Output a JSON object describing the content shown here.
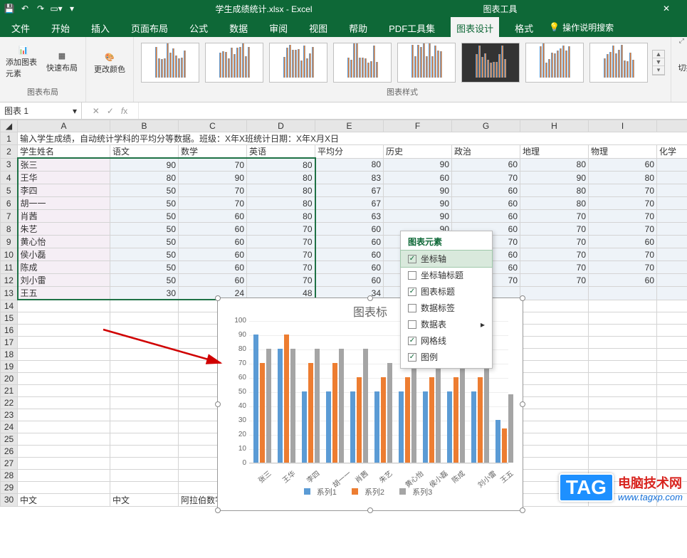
{
  "titlebar": {
    "filename": "学生成绩统计.xlsx - Excel",
    "chart_tools": "图表工具",
    "close": "✕"
  },
  "tabs": {
    "file": "文件",
    "home": "开始",
    "insert": "插入",
    "page_layout": "页面布局",
    "formulas": "公式",
    "data": "数据",
    "review": "审阅",
    "view": "视图",
    "help": "帮助",
    "pdf": "PDF工具集",
    "chart_design": "图表设计",
    "format": "格式",
    "tell_me": "操作说明搜索"
  },
  "ribbon": {
    "add_element": "添加图表元素",
    "quick_layout": "快速布局",
    "change_colors": "更改颜色",
    "group_layout": "图表布局",
    "group_styles": "图表样式",
    "switch_rc": "切换行/列",
    "group_data": "数"
  },
  "name_box": "图表 1",
  "sheet": {
    "row1": "输入学生成绩，自动统计学科的平均分等数据。班级：X年X班统计日期：X年X月X日",
    "headers": {
      "name": "学生姓名",
      "yuwen": "语文",
      "shuxue": "数学",
      "yingyu": "英语",
      "avg": "平均分",
      "lishi": "历史",
      "zhengzhi": "政治",
      "dili": "地理",
      "wuli": "物理",
      "huaxue": "化学"
    },
    "rows": [
      {
        "name": "张三",
        "yw": 90,
        "sx": 70,
        "yy": 80,
        "avg": 80,
        "ls": 90,
        "zz": 60,
        "dl": 80,
        "wl": 60
      },
      {
        "name": "王华",
        "yw": 80,
        "sx": 90,
        "yy": 80,
        "avg": 83,
        "ls": 60,
        "zz": 70,
        "dl": 90,
        "wl": 80
      },
      {
        "name": "李四",
        "yw": 50,
        "sx": 70,
        "yy": 80,
        "avg": 67,
        "ls": 90,
        "zz": 60,
        "dl": 80,
        "wl": 70
      },
      {
        "name": "胡一一",
        "yw": 50,
        "sx": 70,
        "yy": 80,
        "avg": 67,
        "ls": 90,
        "zz": 60,
        "dl": 80,
        "wl": 70
      },
      {
        "name": "肖茜",
        "yw": 50,
        "sx": 60,
        "yy": 80,
        "avg": 63,
        "ls": 90,
        "zz": 60,
        "dl": 70,
        "wl": 70
      },
      {
        "name": "朱艺",
        "yw": 50,
        "sx": 60,
        "yy": 70,
        "avg": 60,
        "ls": 90,
        "zz": 60,
        "dl": 70,
        "wl": 70
      },
      {
        "name": "黄心怡",
        "yw": 50,
        "sx": 60,
        "yy": 70,
        "avg": 60,
        "ls": "",
        "zz": 70,
        "dl": 70,
        "wl": 60
      },
      {
        "name": "侯小磊",
        "yw": 50,
        "sx": 60,
        "yy": 70,
        "avg": 60,
        "ls": "",
        "zz": 60,
        "dl": 70,
        "wl": 70
      },
      {
        "name": "陈成",
        "yw": 50,
        "sx": 60,
        "yy": 70,
        "avg": 60,
        "ls": "",
        "zz": 60,
        "dl": 70,
        "wl": 70
      },
      {
        "name": "刘小雷",
        "yw": 50,
        "sx": 60,
        "yy": 70,
        "avg": 60,
        "ls": "",
        "zz": 70,
        "dl": 70,
        "wl": 60
      },
      {
        "name": "王五",
        "yw": 30,
        "sx": 24,
        "yy": 48,
        "avg": 34,
        "ls": "",
        "zz": "",
        "dl": "",
        "wl": ""
      }
    ],
    "row30": {
      "a": "中文",
      "b": "中文",
      "c": "阿拉伯数字"
    }
  },
  "chart_elements": {
    "title": "图表元素",
    "items": {
      "axes": "坐标轴",
      "axis_titles": "坐标轴标题",
      "chart_title": "图表标题",
      "data_labels": "数据标签",
      "data_table": "数据表",
      "gridlines": "网格线",
      "legend": "图例"
    }
  },
  "chart_data": {
    "type": "bar",
    "title": "图表标",
    "categories": [
      "张三",
      "王华",
      "李四",
      "胡一一",
      "肖茜",
      "朱艺",
      "黄心怡",
      "侯小磊",
      "陈成",
      "刘小雷",
      "王五"
    ],
    "series": [
      {
        "name": "系列1",
        "values": [
          90,
          80,
          50,
          50,
          50,
          50,
          50,
          50,
          50,
          50,
          30
        ]
      },
      {
        "name": "系列2",
        "values": [
          70,
          90,
          70,
          70,
          60,
          60,
          60,
          60,
          60,
          60,
          24
        ]
      },
      {
        "name": "系列3",
        "values": [
          80,
          80,
          80,
          80,
          80,
          70,
          70,
          70,
          70,
          70,
          48
        ]
      }
    ],
    "ylim": [
      0,
      100
    ],
    "yticks": [
      0,
      10,
      20,
      30,
      40,
      50,
      60,
      70,
      80,
      90,
      100
    ]
  },
  "watermark": {
    "tag": "TAG",
    "line1": "电脑技术网",
    "line2": "www.tagxp.com"
  }
}
